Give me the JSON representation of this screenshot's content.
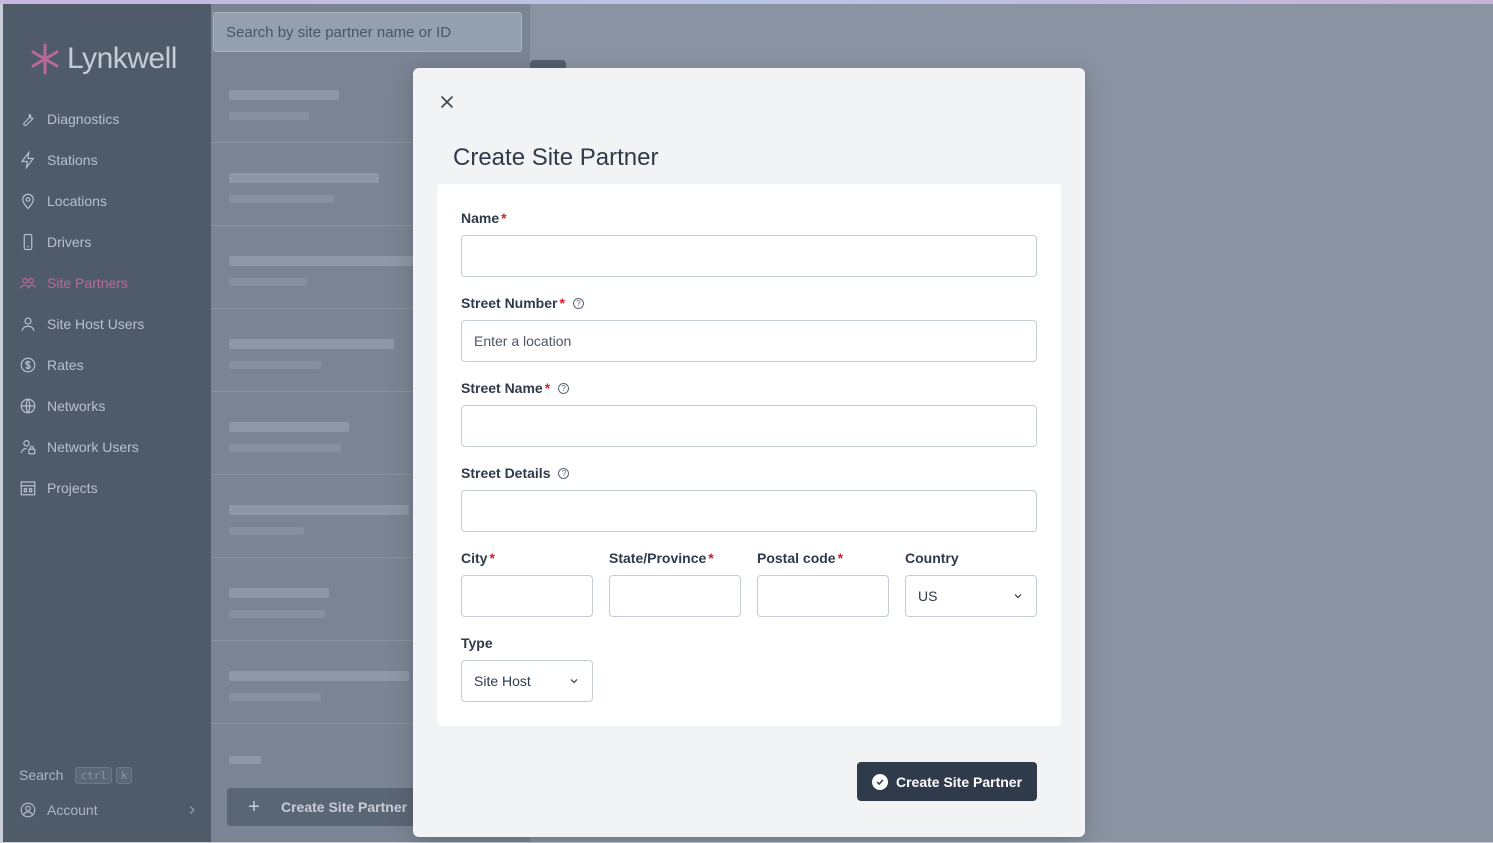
{
  "brand": {
    "name": "Lynkwell",
    "accent": "#b86a95"
  },
  "sidebar": {
    "items": [
      {
        "label": "Diagnostics",
        "icon": "wrench-icon"
      },
      {
        "label": "Stations",
        "icon": "bolt-icon"
      },
      {
        "label": "Locations",
        "icon": "map-pin-icon"
      },
      {
        "label": "Drivers",
        "icon": "phone-icon"
      },
      {
        "label": "Site Partners",
        "icon": "users-icon",
        "active": true
      },
      {
        "label": "Site Host Users",
        "icon": "user-icon"
      },
      {
        "label": "Rates",
        "icon": "dollar-icon"
      },
      {
        "label": "Networks",
        "icon": "globe-icon"
      },
      {
        "label": "Network Users",
        "icon": "user-lock-icon"
      },
      {
        "label": "Projects",
        "icon": "building-icon"
      }
    ],
    "search_label": "Search",
    "shortcut_ctrl": "ctrl",
    "shortcut_key": "k",
    "account_label": "Account"
  },
  "list": {
    "search_placeholder": "Search by site partner name or ID",
    "create_label": "Create Site Partner"
  },
  "modal": {
    "title": "Create Site Partner",
    "fields": {
      "name_label": "Name",
      "street_number_label": "Street Number",
      "street_number_placeholder": "Enter a location",
      "street_name_label": "Street Name",
      "street_details_label": "Street Details",
      "city_label": "City",
      "state_label": "State/Province",
      "postal_label": "Postal code",
      "country_label": "Country",
      "country_value": "US",
      "type_label": "Type",
      "type_value": "Site Host"
    },
    "required_mark": "*",
    "submit_label": "Create Site Partner"
  }
}
